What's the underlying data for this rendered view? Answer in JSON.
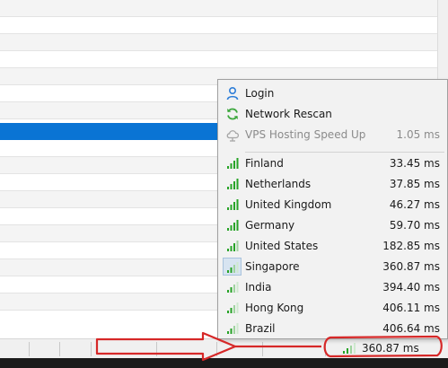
{
  "menu": {
    "items": [
      {
        "id": "login",
        "label": "Login",
        "value": "",
        "icon": "user-icon",
        "state": "normal"
      },
      {
        "id": "network-rescan",
        "label": "Network Rescan",
        "value": "",
        "icon": "refresh-icon",
        "state": "normal"
      },
      {
        "id": "vps-hosting",
        "label": "VPS Hosting Speed Up",
        "value": "1.05 ms",
        "icon": "cloud-icon",
        "state": "disabled"
      }
    ],
    "servers": [
      {
        "label": "Finland",
        "value": "33.45 ms",
        "icon": "signal-icon",
        "active": false
      },
      {
        "label": "Netherlands",
        "value": "37.85 ms",
        "icon": "signal-icon",
        "active": false
      },
      {
        "label": "United Kingdom",
        "value": "46.27 ms",
        "icon": "signal-icon",
        "active": false
      },
      {
        "label": "Germany",
        "value": "59.70 ms",
        "icon": "signal-icon",
        "active": false
      },
      {
        "label": "United States",
        "value": "182.85 ms",
        "icon": "signal-icon",
        "active": false
      },
      {
        "label": "Singapore",
        "value": "360.87 ms",
        "icon": "signal-icon",
        "active": true
      },
      {
        "label": "India",
        "value": "394.40 ms",
        "icon": "signal-icon",
        "active": false
      },
      {
        "label": "Hong Kong",
        "value": "406.11 ms",
        "icon": "signal-icon",
        "active": false
      },
      {
        "label": "Brazil",
        "value": "406.64 ms",
        "icon": "signal-icon",
        "active": false
      }
    ]
  },
  "statusbar": {
    "speed_value": "360.87 ms",
    "speed_icon": "signal-icon"
  },
  "colors": {
    "selection": "#0a74d4",
    "signal_green": "#27a327",
    "annotation_red": "#d62828",
    "user_icon_blue": "#2f7ed8"
  }
}
